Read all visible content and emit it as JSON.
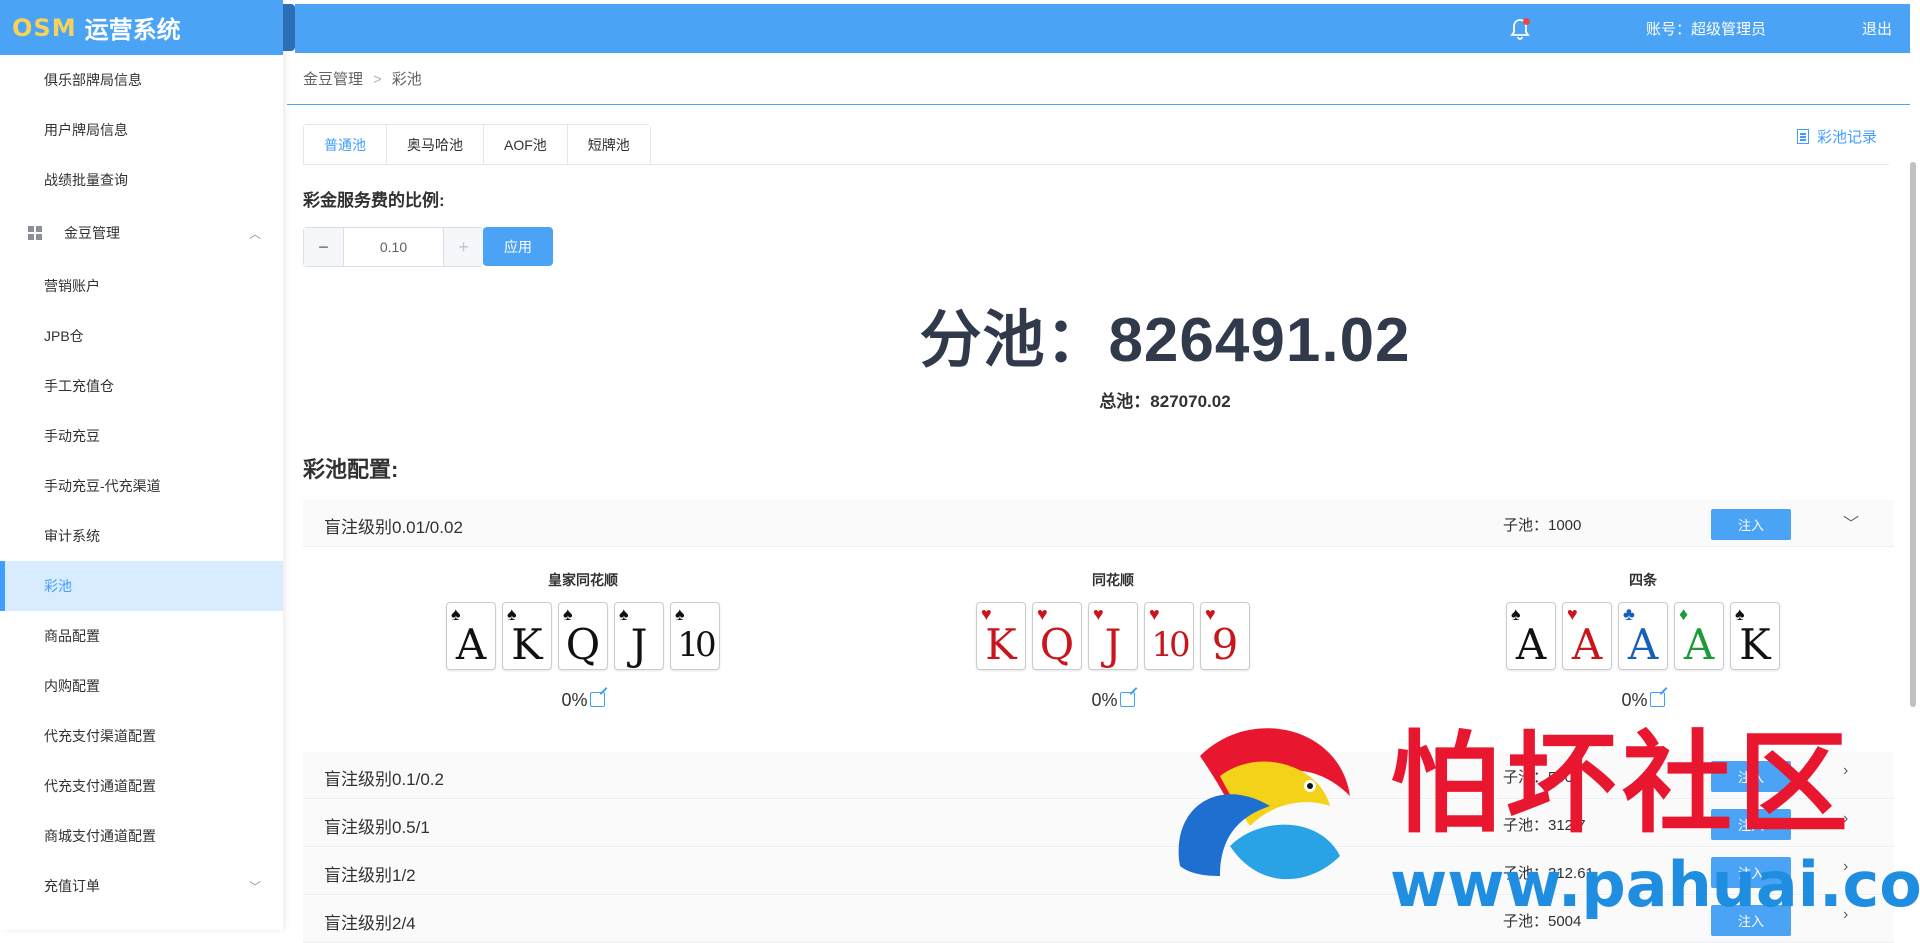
{
  "app": {
    "brand": "OSM",
    "title": "运营系统"
  },
  "header": {
    "account_label": "账号：超级管理员",
    "logout": "退出"
  },
  "sidebar": {
    "items": [
      {
        "label": "俱乐部牌局信息"
      },
      {
        "label": "用户牌局信息"
      },
      {
        "label": "战绩批量查询"
      },
      {
        "label": "金豆管理",
        "group": true,
        "expanded": true
      },
      {
        "label": "营销账户"
      },
      {
        "label": "JPB仓"
      },
      {
        "label": "手工充值仓"
      },
      {
        "label": "手动充豆"
      },
      {
        "label": "手动充豆-代充渠道"
      },
      {
        "label": "审计系统"
      },
      {
        "label": "彩池",
        "active": true
      },
      {
        "label": "商品配置"
      },
      {
        "label": "内购配置"
      },
      {
        "label": "代充支付渠道配置"
      },
      {
        "label": "代充支付通道配置"
      },
      {
        "label": "商城支付通道配置"
      },
      {
        "label": "充值订单"
      }
    ]
  },
  "breadcrumb": [
    "金豆管理",
    "彩池"
  ],
  "tabs": [
    {
      "label": "普通池",
      "active": true
    },
    {
      "label": "奥马哈池"
    },
    {
      "label": "AOF池"
    },
    {
      "label": "短牌池"
    }
  ],
  "record_link": "彩池记录",
  "fee_label": "彩金服务费的比例:",
  "fee": {
    "value": "0.10",
    "minus": "−",
    "plus": "+",
    "apply": "应用"
  },
  "subpool_text": "分池：826491.02",
  "totalpool_text": "总池：827070.02",
  "config_label": "彩池配置:",
  "levels": [
    {
      "name": "盲注级别0.01/0.02",
      "subpool": "子池：1000",
      "inject": "注入",
      "expanded": true
    },
    {
      "name": "盲注级别0.1/0.2",
      "subpool": "子池：5000",
      "inject": "注入"
    },
    {
      "name": "盲注级别0.5/1",
      "subpool": "子池：312.7",
      "inject": "注入"
    },
    {
      "name": "盲注级别1/2",
      "subpool": "子池：312.61",
      "inject": "注入"
    },
    {
      "name": "盲注级别2/4",
      "subpool": "子池：5004",
      "inject": "注入"
    }
  ],
  "hands": [
    {
      "title": "皇家同花顺",
      "percent": "0%",
      "cards": [
        {
          "rank": "A",
          "suit": "♠",
          "color": "#111111"
        },
        {
          "rank": "K",
          "suit": "♠",
          "color": "#111111"
        },
        {
          "rank": "Q",
          "suit": "♠",
          "color": "#111111"
        },
        {
          "rank": "J",
          "suit": "♠",
          "color": "#111111"
        },
        {
          "rank": "10",
          "suit": "♠",
          "color": "#111111"
        }
      ]
    },
    {
      "title": "同花顺",
      "percent": "0%",
      "cards": [
        {
          "rank": "K",
          "suit": "♥",
          "color": "#c8161d"
        },
        {
          "rank": "Q",
          "suit": "♥",
          "color": "#c8161d"
        },
        {
          "rank": "J",
          "suit": "♥",
          "color": "#c8161d"
        },
        {
          "rank": "10",
          "suit": "♥",
          "color": "#c8161d"
        },
        {
          "rank": "9",
          "suit": "♥",
          "color": "#c8161d"
        }
      ]
    },
    {
      "title": "四条",
      "percent": "0%",
      "cards": [
        {
          "rank": "A",
          "suit": "♠",
          "color": "#111111"
        },
        {
          "rank": "A",
          "suit": "♥",
          "color": "#c8161d"
        },
        {
          "rank": "A",
          "suit": "♣",
          "color": "#1560bd"
        },
        {
          "rank": "A",
          "suit": "♦",
          "color": "#1e9a3a"
        },
        {
          "rank": "K",
          "suit": "♠",
          "color": "#111111"
        }
      ]
    }
  ],
  "watermark": {
    "text": "怕坏社区",
    "url": "www.pahuai.com"
  },
  "colors": {
    "accent": "#409eff",
    "header": "#4aa3f5"
  }
}
